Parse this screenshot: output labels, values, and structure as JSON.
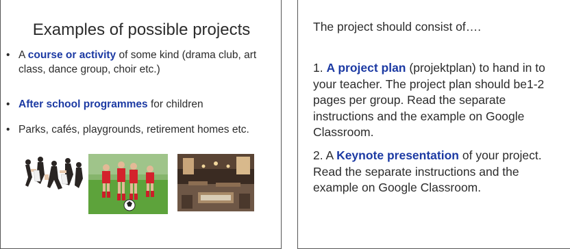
{
  "left_slide": {
    "title": "Examples of possible projects",
    "bullet_1": {
      "emphasis": "course or activity",
      "pre": "A ",
      "post": " of some kind (drama club, art class, dance group, choir etc.)"
    },
    "bullet_2": {
      "emphasis": "After school programmes",
      "post": " for children"
    },
    "bullet_3": {
      "text": "Parks, cafés, playgrounds, retirement homes etc."
    },
    "bullet_glyph": "•",
    "images": [
      "dancers-photo",
      "children-soccer-photo",
      "cafe-interior-photo"
    ]
  },
  "right_slide": {
    "intro": "The project should consist of….",
    "item_1": {
      "number": "1. ",
      "emphasis": "A project plan",
      "rest": " (projektplan) to hand in to your teacher. The project plan should be1-2 pages per group. Read the separate instructions and the example on Google Classroom."
    },
    "item_2": {
      "number": "2. A ",
      "emphasis": "Keynote presentation",
      "rest": " of your project. Read the separate instructions and the example on Google Classroom."
    }
  },
  "colors": {
    "emphasis": "#1c3aa3",
    "text": "#2b2b2b",
    "border": "#555555"
  }
}
